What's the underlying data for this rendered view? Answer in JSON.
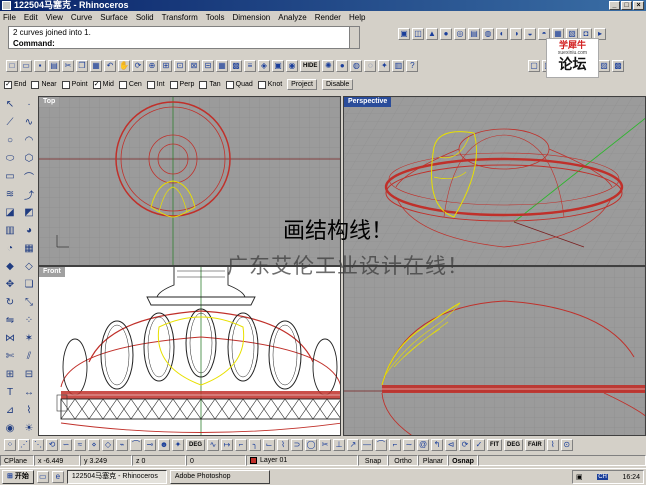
{
  "window": {
    "title": "122504马塞克 - Rhinoceros",
    "min": "_",
    "max": "□",
    "close": "×"
  },
  "menu": [
    "File",
    "Edit",
    "View",
    "Curve",
    "Surface",
    "Solid",
    "Transform",
    "Tools",
    "Dimension",
    "Analyze",
    "Render",
    "Help"
  ],
  "command": {
    "history": "2 curves joined into 1.",
    "prompt": "Command:"
  },
  "osnap": {
    "items": [
      {
        "label": "End",
        "checked": true
      },
      {
        "label": "Near",
        "checked": false
      },
      {
        "label": "Point",
        "checked": false
      },
      {
        "label": "Mid",
        "checked": true
      },
      {
        "label": "Cen",
        "checked": false
      },
      {
        "label": "Int",
        "checked": false
      },
      {
        "label": "Perp",
        "checked": false
      },
      {
        "label": "Tan",
        "checked": false
      },
      {
        "label": "Quad",
        "checked": false
      },
      {
        "label": "Knot",
        "checked": false
      }
    ],
    "project": "Project",
    "disable": "Disable"
  },
  "toolbar_text": {
    "hide": "HIDE",
    "deg": "DEG",
    "fit": "FIT",
    "fair": "FAIR"
  },
  "viewports": {
    "top": "Top",
    "perspective": "Perspective",
    "front": "Front"
  },
  "overlay": {
    "line1": "画结构线！",
    "line2": "广东艾伦工业设计在线！"
  },
  "logo": {
    "line1": "学犀牛",
    "line2": "xuexiniu.com",
    "line3": "论坛"
  },
  "status": {
    "cplane": "CPlane",
    "x": "x -6.449",
    "y": "y 3.249",
    "z": "z 0",
    "zero": "0",
    "layer": "Layer 01",
    "snap": "Snap",
    "ortho": "Ortho",
    "planar": "Planar",
    "osnap": "Osnap"
  },
  "taskbar": {
    "start": "开始",
    "tasks": [
      "122504马塞克 - Rhinoceros",
      "Adobe Photoshop"
    ],
    "lang": "CH",
    "time": "16:24"
  },
  "colors": {
    "curve": "#c0302a",
    "selected": "#e8e000",
    "gridbg": "#9b9b9b",
    "axis_green": "#2fb52f"
  }
}
